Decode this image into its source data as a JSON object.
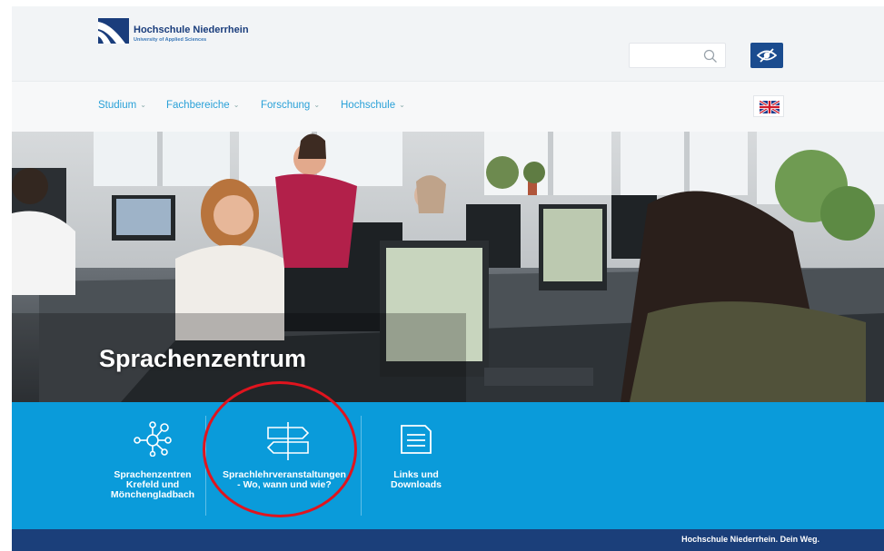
{
  "header": {
    "logo": {
      "name": "Hochschule Niederrhein",
      "subtitle": "University of Applied Sciences"
    },
    "search": {
      "placeholder": "",
      "icon": "search-icon"
    },
    "accessibility_button": {
      "icon": "eye-accessibility-icon"
    }
  },
  "nav": {
    "items": [
      {
        "label": "Studium"
      },
      {
        "label": "Fachbereiche"
      },
      {
        "label": "Forschung"
      },
      {
        "label": "Hochschule"
      }
    ],
    "language_switch": {
      "icon": "uk-flag-icon"
    }
  },
  "hero": {
    "title": "Sprachenzentrum"
  },
  "tiles": [
    {
      "label": "Sprachenzentren\nKrefeld und\nMönchengladbach",
      "icon": "network-icon"
    },
    {
      "label": "Sprachlehrveranstaltungen\n- Wo, wann und wie?",
      "icon": "signpost-icon"
    },
    {
      "label": "Links und\nDownloads",
      "icon": "document-icon"
    }
  ],
  "footer": {
    "slogan": "Hochschule Niederrhein. Dein Weg."
  },
  "colors": {
    "brand_dark_blue": "#1b3f7a",
    "tile_band_blue": "#0a9bda",
    "nav_link_blue": "#2aa1d8",
    "highlight_red": "#e0141e"
  }
}
